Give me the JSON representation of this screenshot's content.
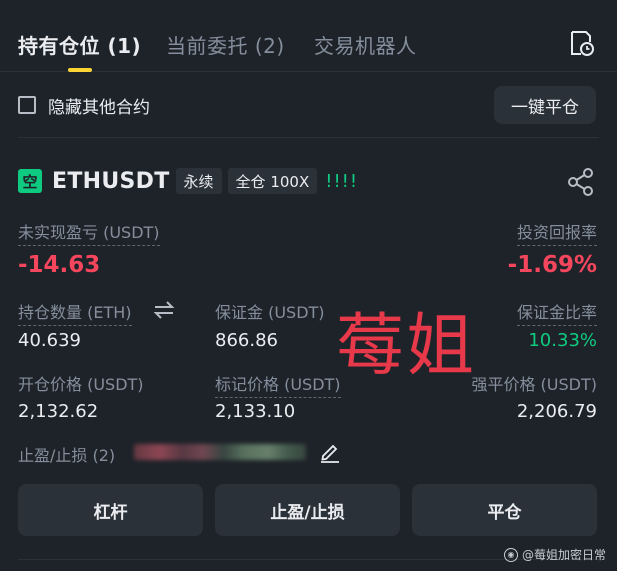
{
  "tabs": [
    {
      "label": "持有仓位 (1)",
      "active": true
    },
    {
      "label": "当前委托 (2)",
      "active": false
    },
    {
      "label": "交易机器人",
      "active": false
    }
  ],
  "filters": {
    "hide_other_label": "隐藏其他合约",
    "close_all_label": "一键平仓"
  },
  "position": {
    "badge": "空",
    "symbol": "ETHUSDT",
    "tags": [
      "永续",
      "全仓 100X"
    ],
    "warning": "!!!!",
    "unrealized_pnl_label": "未实现盈亏 (USDT)",
    "unrealized_pnl_value": "-14.63",
    "roi_label": "投资回报率",
    "roi_value": "-1.69%",
    "size_label": "持仓数量 (ETH)",
    "size_value": "40.639",
    "margin_label": "保证金 (USDT)",
    "margin_value": "866.86",
    "margin_ratio_label": "保证金比率",
    "margin_ratio_value": "10.33%",
    "entry_price_label": "开仓价格 (USDT)",
    "entry_price_value": "2,132.62",
    "mark_price_label": "标记价格 (USDT)",
    "mark_price_value": "2,133.10",
    "liq_price_label": "强平价格 (USDT)",
    "liq_price_value": "2,206.79",
    "tpsl_label": "止盈/止损 (2)"
  },
  "actions": {
    "leverage_label": "杠杆",
    "tpsl_label": "止盈/止损",
    "close_label": "平仓"
  },
  "overlay": {
    "watermark_text": "莓姐",
    "footer_text": "@莓姐加密日常"
  },
  "colors": {
    "background": "#1e2329",
    "loss": "#f6465d",
    "profit": "#0ecb81",
    "accent": "#fcd535"
  },
  "icons": [
    "history-icon",
    "share-icon",
    "swap-icon",
    "edit-icon"
  ]
}
